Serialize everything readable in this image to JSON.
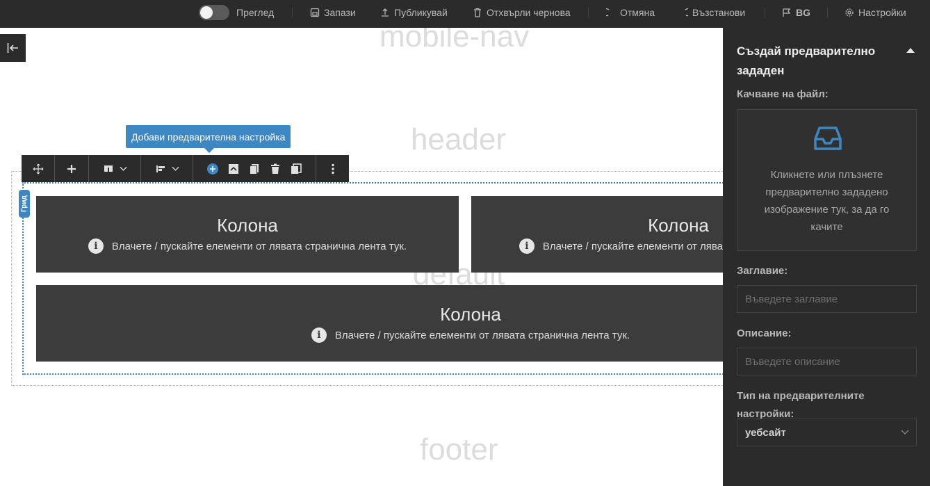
{
  "topbar": {
    "preview_label": "Преглед",
    "preview_on": false,
    "save_label": "Запази",
    "publish_label": "Публикувай",
    "discard_label": "Отхвърли чернова",
    "undo_label": "Отмяна",
    "redo_label": "Възстанови",
    "language_label": "BG",
    "settings_label": "Настройки"
  },
  "canvas": {
    "regions": {
      "mobile_nav": "mobile-nav",
      "header": "header",
      "default": "default",
      "footer": "footer"
    },
    "grid_badge": "Грид",
    "tooltip": "Добави предварителна настройка",
    "columns": [
      {
        "title": "Колона",
        "hint": "Влачете / пускайте елементи от лявата странична лента тук."
      },
      {
        "title": "Колона",
        "hint": "Влачете / пускайте елементи от лявата странична лента тук."
      },
      {
        "title": "Колона",
        "hint": "Влачете / пускайте елементи от лявата странична лента тук."
      }
    ],
    "info_glyph": "i"
  },
  "panel": {
    "title": "Създай предварително зададен",
    "file_label": "Качване на файл:",
    "dropzone_text": "Кликнете или плъзнете предварително зададено изображение тук, за да го качите",
    "title_label": "Заглавие:",
    "title_placeholder": "Въведете заглавие",
    "description_label": "Описание:",
    "description_placeholder": "Въведете описание",
    "type_label": "Тип на предварителните настройки:",
    "type_value": "уебсайт"
  },
  "colors": {
    "accent": "#3d87c3",
    "dark": "#2b2b2b",
    "column": "#3c3c3c"
  }
}
